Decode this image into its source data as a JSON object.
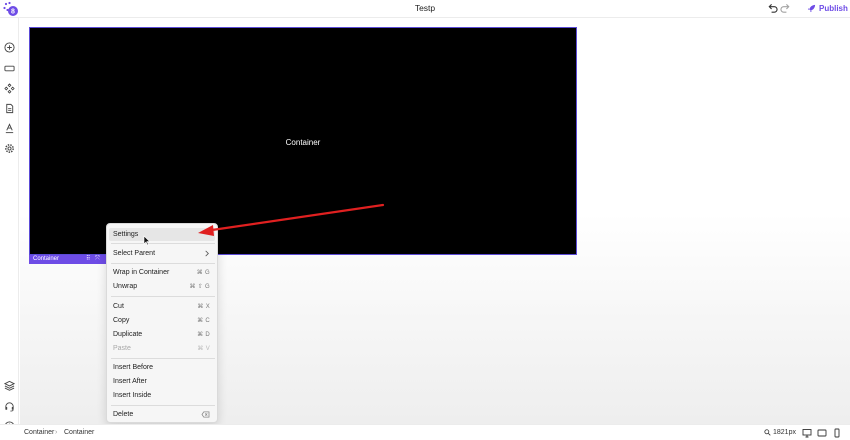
{
  "app": {
    "title": "Testp",
    "publish_label": "Publish",
    "logo_badge": "8"
  },
  "colors": {
    "accent": "#6e4ce6",
    "arrow": "#e02020",
    "canvas_element_bg": "#000000"
  },
  "sidebar": {
    "top_icons": [
      "add-icon",
      "layout-icon",
      "components-icon",
      "pages-icon",
      "typography-icon",
      "settings-gear-icon"
    ],
    "bottom_icons": [
      "layers-icon",
      "support-icon",
      "info-icon"
    ]
  },
  "canvas": {
    "container_label": "Container",
    "selection_label": "Container"
  },
  "context_menu": {
    "items": [
      {
        "label": "Settings",
        "shortcut": ""
      },
      {
        "label": "Select Parent",
        "shortcut": ""
      },
      {
        "label": "Wrap in Container",
        "shortcut": "⌘ G"
      },
      {
        "label": "Unwrap",
        "shortcut": "⌘ ⇧ G"
      },
      {
        "label": "Cut",
        "shortcut": "⌘ X"
      },
      {
        "label": "Copy",
        "shortcut": "⌘ C"
      },
      {
        "label": "Duplicate",
        "shortcut": "⌘ D"
      },
      {
        "label": "Paste",
        "shortcut": "⌘ V"
      },
      {
        "label": "Insert Before",
        "shortcut": ""
      },
      {
        "label": "Insert After",
        "shortcut": ""
      },
      {
        "label": "Insert Inside",
        "shortcut": ""
      },
      {
        "label": "Delete",
        "shortcut": ""
      }
    ]
  },
  "bottom": {
    "breadcrumb": [
      "Container",
      "Container"
    ],
    "zoom_label": "1821px"
  }
}
